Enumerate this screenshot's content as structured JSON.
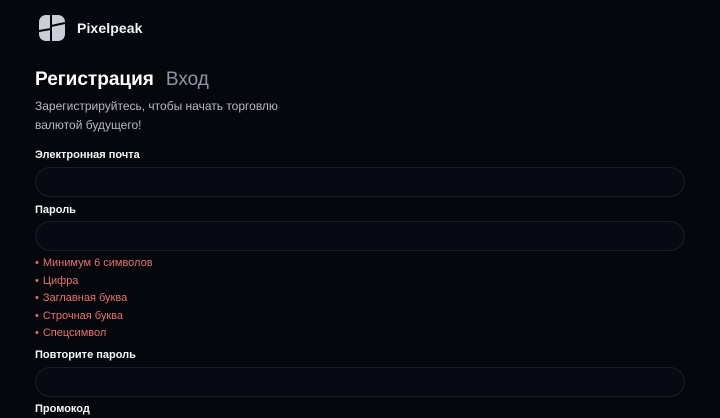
{
  "brand": {
    "name": "Pixelpeak",
    "logo_icon": "pixelpeak-logo-icon",
    "logo_color": "#c9cdd6"
  },
  "tabs": {
    "register_label": "Регистрация",
    "login_label": "Вход"
  },
  "subtitle": "Зарегистрируйтесь, чтобы начать торговлю валютой будущего!",
  "form": {
    "email_label": "Электронная почта",
    "email_value": "",
    "password_label": "Пароль",
    "password_value": "",
    "password_rules": [
      "Минимум 6 символов",
      "Цифра",
      "Заглавная буква",
      "Строчная буква",
      "Спецсимвол"
    ],
    "repeat_password_label": "Повторите пароль",
    "repeat_password_value": "",
    "promo_label": "Промокод"
  },
  "colors": {
    "background": "#05070d",
    "field_border": "#1a1e28",
    "rule_error": "#e5736d",
    "tab_inactive": "#8f95a3"
  }
}
